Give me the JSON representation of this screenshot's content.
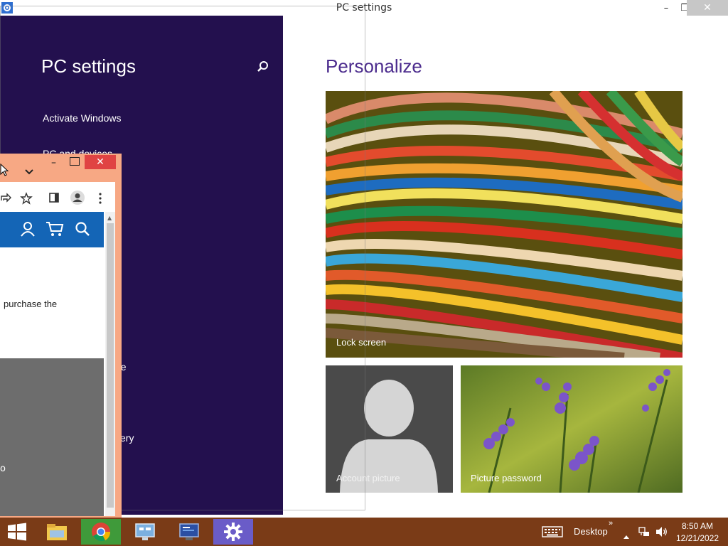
{
  "window": {
    "title": "PC settings",
    "minimize": "–",
    "restore": "❐",
    "close": "✕"
  },
  "left_pane": {
    "title": "PC settings",
    "items": [
      "Activate Windows",
      "PC and devices",
      "ge",
      "very"
    ]
  },
  "main": {
    "heading": "Personalize",
    "tiles": {
      "lock_screen": "Lock screen",
      "account_picture": "Account picture",
      "picture_password": "Picture password"
    }
  },
  "chrome_window": {
    "body_text": "purchase the",
    "bottom_text": "o",
    "minimize": "–",
    "close": "✕"
  },
  "taskbar": {
    "desktop_label": "Desktop",
    "chevron": "»",
    "time": "8:50 AM",
    "date": "12/21/2022"
  },
  "colors": {
    "left_pane": "#23104e",
    "accent": "#4b2b8d",
    "taskbar": "#7a3b17"
  }
}
